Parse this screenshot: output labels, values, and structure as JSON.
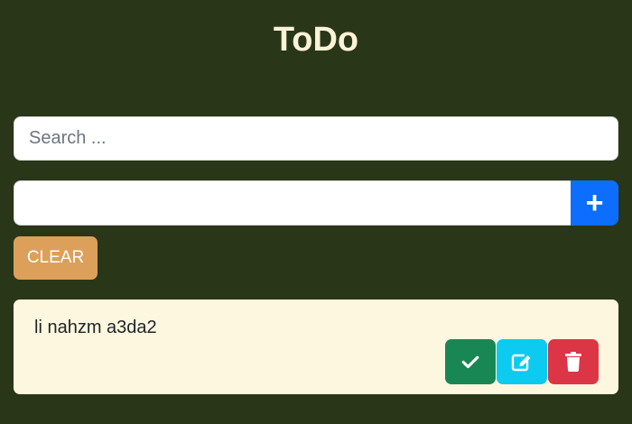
{
  "header": {
    "title": "ToDo"
  },
  "search": {
    "placeholder": "Search ...",
    "value": ""
  },
  "new_todo": {
    "value": "",
    "add_icon": "plus-icon",
    "add_symbol": "+"
  },
  "clear_button": {
    "label": "CLEAR"
  },
  "todos": [
    {
      "text": "li nahzm a3da2",
      "actions": [
        {
          "name": "complete",
          "icon": "check-icon",
          "color": "#198754"
        },
        {
          "name": "edit",
          "icon": "edit-icon",
          "color": "#0dcaf0"
        },
        {
          "name": "delete",
          "icon": "trash-icon",
          "color": "#dc3545"
        }
      ]
    }
  ],
  "colors": {
    "background": "#2a3618",
    "title": "#fbf3d8",
    "add_button": "#0d6efd",
    "clear_button": "#dca05a",
    "todo_background": "#fdf7df"
  }
}
